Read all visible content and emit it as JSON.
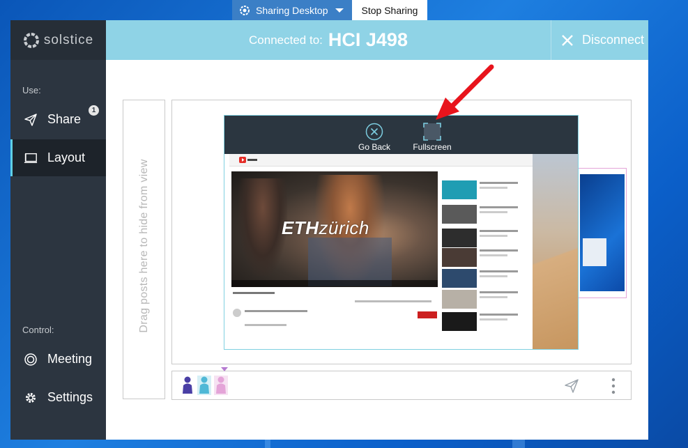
{
  "share_bar": {
    "sharing_label": "Sharing Desktop",
    "stop_label": "Stop Sharing"
  },
  "app": {
    "logo_text": "solstice"
  },
  "header": {
    "connected_prefix": "Connected to:",
    "room_name": "HCI J498",
    "disconnect_label": "Disconnect"
  },
  "sidebar": {
    "use_label": "Use:",
    "items": [
      {
        "label": "Share",
        "icon": "send-icon",
        "badge": "1",
        "active": false
      },
      {
        "label": "Layout",
        "icon": "layout-icon",
        "active": true
      }
    ],
    "control_label": "Control:",
    "control_items": [
      {
        "label": "Meeting",
        "icon": "meeting-icon"
      },
      {
        "label": "Settings",
        "icon": "gear-icon"
      }
    ]
  },
  "content": {
    "drag_hint": "Drag posts here to hide from view",
    "post_controls": {
      "back_label": "Go Back",
      "fullscreen_label": "Fullscreen"
    },
    "video_watermark_bold": "ETH",
    "video_watermark_light": "zürich"
  },
  "colors": {
    "sidebar_bg": "#2c3540",
    "header_bg": "#8fd3e6",
    "accent": "#5fd0e6",
    "arrow": "#e8141c",
    "person_colors": [
      "#4a3fa5",
      "#4fb8d6",
      "#e4a4d8"
    ]
  }
}
